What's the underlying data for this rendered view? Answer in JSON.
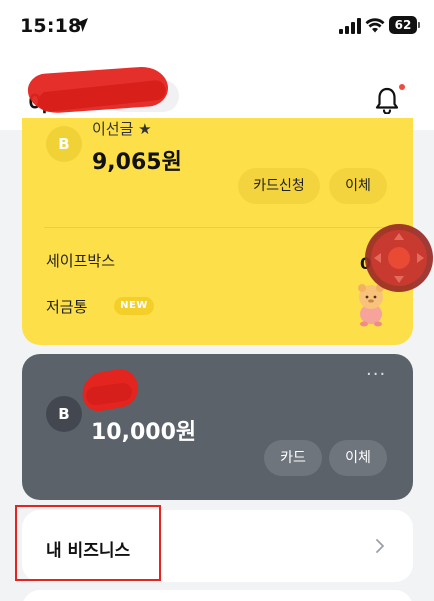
{
  "status_bar": {
    "time": "15:18",
    "battery": "62",
    "icons": [
      "location-arrow-icon",
      "signal-icon",
      "wifi-icon",
      "battery-icon"
    ]
  },
  "header": {
    "user_name": "이",
    "business_pill": "바",
    "notification_dot_color": "#ef4b3f"
  },
  "main_account": {
    "avatar_letter": "B",
    "name": "이선글 ★",
    "balance": "9,065원",
    "buttons": {
      "card_apply": "카드신청",
      "transfer": "이체"
    },
    "safe_box": {
      "label": "세이프박스",
      "amount": "0원"
    },
    "piggy_bank": {
      "label": "저금통",
      "badge": "NEW"
    },
    "card_color": "#fde049"
  },
  "second_account": {
    "avatar_letter": "B",
    "more": "···",
    "balance": "10,000원",
    "buttons": {
      "card": "카드",
      "transfer": "이체"
    },
    "card_color": "#5c626a"
  },
  "my_business": {
    "title": "내 비즈니스"
  },
  "annotation_color": "#e3241f"
}
